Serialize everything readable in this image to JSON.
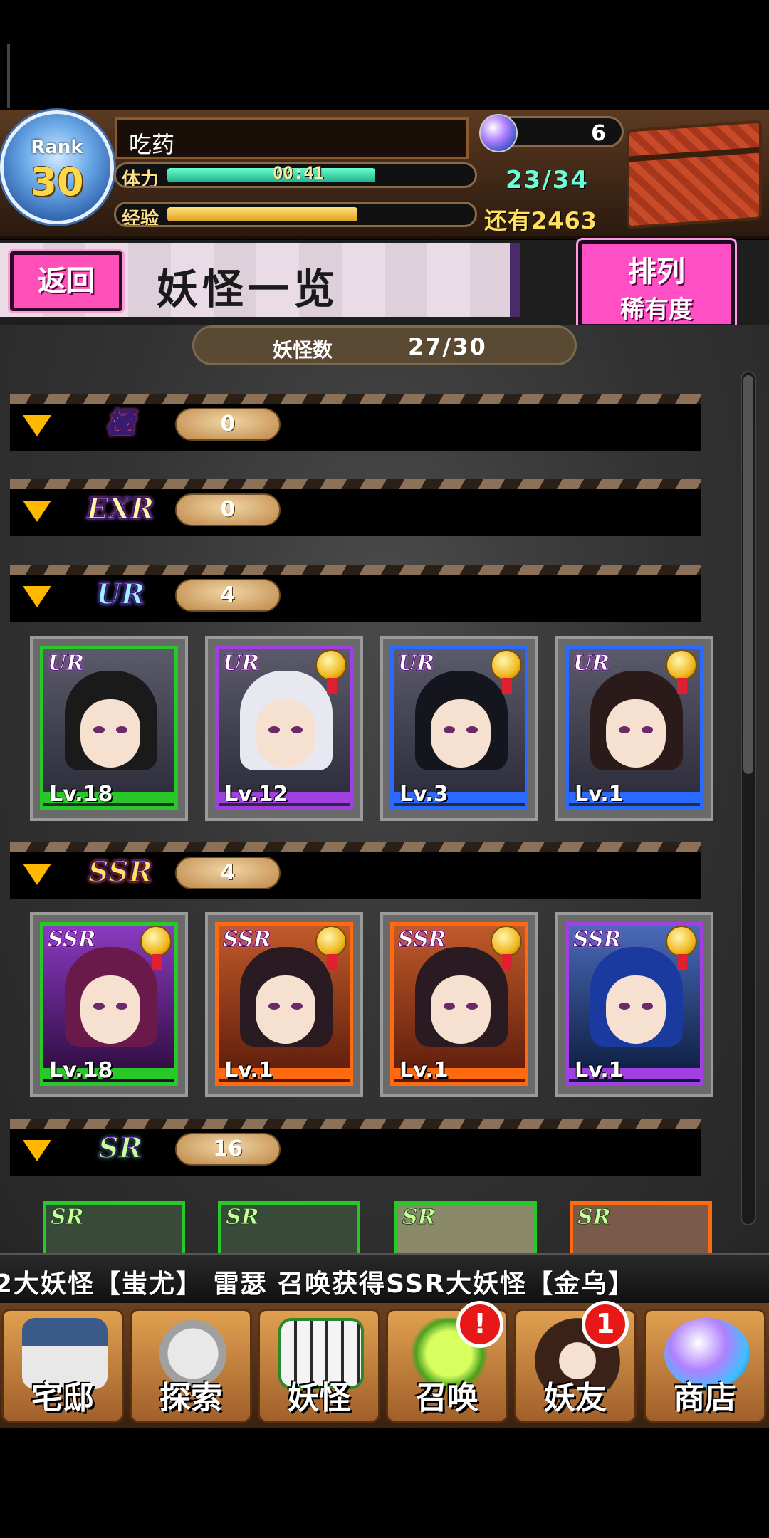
{
  "header": {
    "rank_label": "Rank",
    "rank_value": "30",
    "player_name": "吃药",
    "stamina_label": "体力",
    "stamina_timer": "00:41",
    "stamina_fraction": 0.68,
    "exp_label": "经验",
    "exp_fraction": 0.62,
    "gems": "6",
    "stamina_count": "23/34",
    "exp_remaining": "还有2463"
  },
  "titlebar": {
    "back_label": "返回",
    "title": "妖怪一览",
    "sort_label": "排列",
    "sort_value": "稀有度"
  },
  "list": {
    "count_label": "妖怪数",
    "count_value": "27/30",
    "sections": [
      {
        "rarity": "極",
        "count": "0"
      },
      {
        "rarity": "EXR",
        "count": "0"
      },
      {
        "rarity": "UR",
        "count": "4"
      },
      {
        "rarity": "SSR",
        "count": "4"
      },
      {
        "rarity": "SR",
        "count": "16"
      }
    ],
    "ur_cards": [
      {
        "rarity": "UR",
        "level": "Lv.18",
        "frame": "green",
        "hair": "#1a1a1a"
      },
      {
        "rarity": "UR",
        "level": "Lv.12",
        "frame": "purple",
        "hair": "#e8e8f0"
      },
      {
        "rarity": "UR",
        "level": "Lv.3",
        "frame": "blue",
        "hair": "#15151e"
      },
      {
        "rarity": "UR",
        "level": "Lv.1",
        "frame": "blue",
        "hair": "#2a1a1a"
      }
    ],
    "ssr_cards": [
      {
        "rarity": "SSR",
        "level": "Lv.18",
        "frame": "green",
        "hair": "#6a1a4a"
      },
      {
        "rarity": "SSR",
        "level": "Lv.1",
        "frame": "orange",
        "hair": "#2a1a22"
      },
      {
        "rarity": "SSR",
        "level": "Lv.1",
        "frame": "orange",
        "hair": "#2a1a22"
      },
      {
        "rarity": "SSR",
        "level": "Lv.1",
        "frame": "purple",
        "hair": "#1a3aa0"
      }
    ],
    "sr_peek": [
      "SR",
      "SR",
      "SR",
      "SR"
    ]
  },
  "ticker": {
    "text": "2大妖怪【蚩尤】   雷瑟 召唤获得SSR大妖怪【金乌】"
  },
  "nav": [
    {
      "label": "宅邸",
      "icon": "house-icon",
      "badge": ""
    },
    {
      "label": "探索",
      "icon": "explore-icon",
      "badge": ""
    },
    {
      "label": "妖怪",
      "icon": "yokai-icon",
      "badge": ""
    },
    {
      "label": "召唤",
      "icon": "summon-icon",
      "badge": "!"
    },
    {
      "label": "妖友",
      "icon": "friend-icon",
      "badge": "1"
    },
    {
      "label": "商店",
      "icon": "shop-icon",
      "badge": ""
    }
  ]
}
